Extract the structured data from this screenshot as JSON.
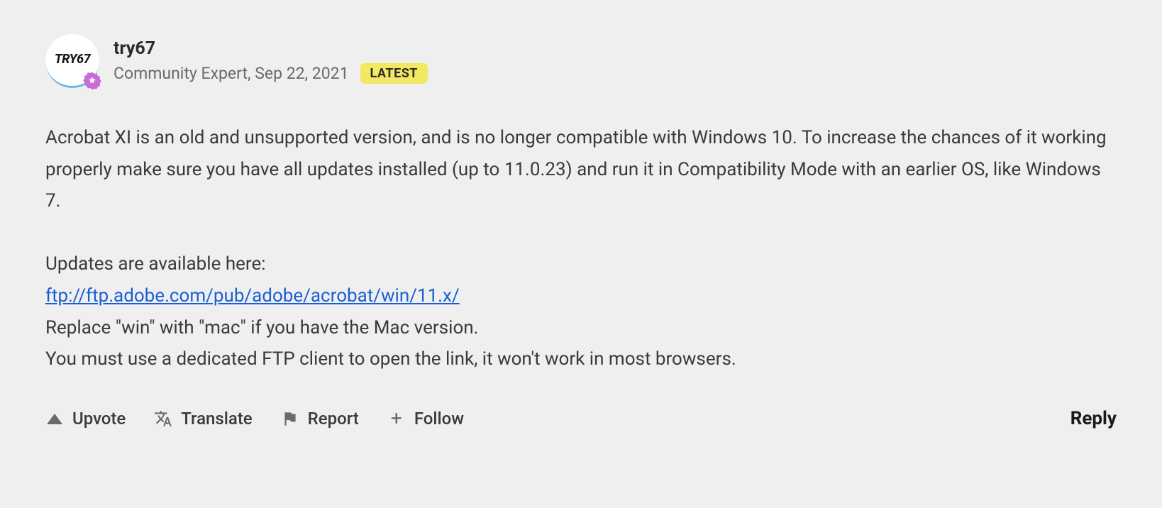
{
  "post": {
    "avatar_text": "TRY67",
    "username": "try67",
    "role": "Community Expert",
    "date": "Sep 22, 2021",
    "badge": "LATEST",
    "body": {
      "p1": "Acrobat XI is an old and unsupported version, and is no longer compatible with Windows 10. To increase the chances of it working properly make sure you have all updates installed (up to 11.0.23) and run it in Compatibility Mode with an earlier OS, like Windows 7.",
      "p2": "Updates are available here:",
      "link": "ftp://ftp.adobe.com/pub/adobe/acrobat/win/11.x/",
      "p3": "Replace \"win\" with \"mac\" if you have the Mac version.",
      "p4": "You must use a dedicated FTP client to open the link, it won't work in most browsers."
    }
  },
  "actions": {
    "upvote": "Upvote",
    "translate": "Translate",
    "report": "Report",
    "follow": "Follow",
    "reply": "Reply"
  }
}
